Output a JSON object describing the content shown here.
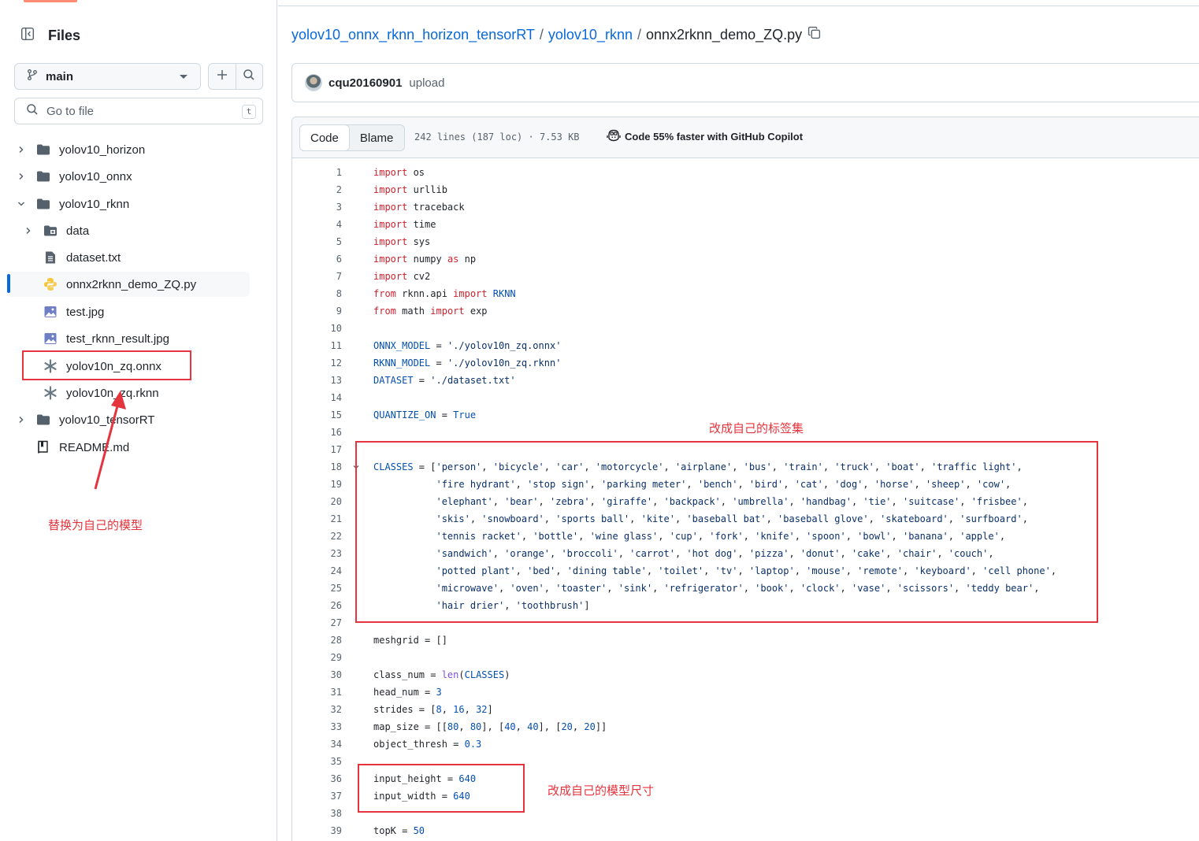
{
  "sidebar": {
    "title": "Files",
    "branch": "main",
    "goto_placeholder": "Go to file",
    "goto_shortcut": "t",
    "tree": [
      {
        "label": "yolov10_horizon",
        "kind": "folder",
        "expanded": false
      },
      {
        "label": "yolov10_onnx",
        "kind": "folder",
        "expanded": false
      },
      {
        "label": "yolov10_rknn",
        "kind": "folder",
        "expanded": true
      },
      {
        "label": "data",
        "kind": "folder-submodule",
        "expanded": false
      },
      {
        "label": "dataset.txt",
        "kind": "file-text"
      },
      {
        "label": "onnx2rknn_demo_ZQ.py",
        "kind": "file-python",
        "active": true
      },
      {
        "label": "test.jpg",
        "kind": "file-image"
      },
      {
        "label": "test_rknn_result.jpg",
        "kind": "file-image"
      },
      {
        "label": "yolov10n_zq.onnx",
        "kind": "file-binary"
      },
      {
        "label": "yolov10n_zq.rknn",
        "kind": "file-binary"
      },
      {
        "label": "yolov10_tensorRT",
        "kind": "folder",
        "expanded": false
      },
      {
        "label": "README.md",
        "kind": "file-readme"
      }
    ]
  },
  "breadcrumb": {
    "repo": "yolov10_onnx_rknn_horizon_tensorRT",
    "folder": "yolov10_rknn",
    "file": "onnx2rknn_demo_ZQ.py",
    "sep": "/"
  },
  "commit": {
    "author": "cqu20160901",
    "message": "upload"
  },
  "file_header": {
    "tab_code": "Code",
    "tab_blame": "Blame",
    "meta": "242 lines (187 loc) · 7.53 KB",
    "copilot": "Code 55% faster with GitHub Copilot"
  },
  "annotations": {
    "model": "替换为自己的模型",
    "classes": "改成自己的标签集",
    "size": "改成自己的模型尺寸"
  },
  "colors": {
    "accent_link": "#0969da",
    "keyword": "#cf222e",
    "constant": "#0550ae",
    "string": "#0a3069",
    "function": "#8250df",
    "annotation_red": "#e5343d"
  },
  "code_lines": [
    [
      [
        "k",
        "import"
      ],
      [
        "t",
        " os"
      ]
    ],
    [
      [
        "k",
        "import"
      ],
      [
        "t",
        " urllib"
      ]
    ],
    [
      [
        "k",
        "import"
      ],
      [
        "t",
        " traceback"
      ]
    ],
    [
      [
        "k",
        "import"
      ],
      [
        "t",
        " time"
      ]
    ],
    [
      [
        "k",
        "import"
      ],
      [
        "t",
        " sys"
      ]
    ],
    [
      [
        "k",
        "import"
      ],
      [
        "t",
        " numpy "
      ],
      [
        "k",
        "as"
      ],
      [
        "t",
        " np"
      ]
    ],
    [
      [
        "k",
        "import"
      ],
      [
        "t",
        " cv2"
      ]
    ],
    [
      [
        "k",
        "from"
      ],
      [
        "t",
        " rknn.api "
      ],
      [
        "k",
        "import"
      ],
      [
        "t",
        " "
      ],
      [
        "c",
        "RKNN"
      ]
    ],
    [
      [
        "k",
        "from"
      ],
      [
        "t",
        " math "
      ],
      [
        "k",
        "import"
      ],
      [
        "t",
        " exp"
      ]
    ],
    [],
    [
      [
        "c",
        "ONNX_MODEL"
      ],
      [
        "t",
        " = "
      ],
      [
        "s",
        "'./yolov10n_zq.onnx'"
      ]
    ],
    [
      [
        "c",
        "RKNN_MODEL"
      ],
      [
        "t",
        " = "
      ],
      [
        "s",
        "'./yolov10n_zq.rknn'"
      ]
    ],
    [
      [
        "c",
        "DATASET"
      ],
      [
        "t",
        " = "
      ],
      [
        "s",
        "'./dataset.txt'"
      ]
    ],
    [],
    [
      [
        "c",
        "QUANTIZE_ON"
      ],
      [
        "t",
        " = "
      ],
      [
        "c",
        "True"
      ]
    ],
    [],
    [],
    [
      [
        "c",
        "CLASSES"
      ],
      [
        "t",
        " = ["
      ],
      [
        "s",
        "'person'"
      ],
      [
        "t",
        ", "
      ],
      [
        "s",
        "'bicycle'"
      ],
      [
        "t",
        ", "
      ],
      [
        "s",
        "'car'"
      ],
      [
        "t",
        ", "
      ],
      [
        "s",
        "'motorcycle'"
      ],
      [
        "t",
        ", "
      ],
      [
        "s",
        "'airplane'"
      ],
      [
        "t",
        ", "
      ],
      [
        "s",
        "'bus'"
      ],
      [
        "t",
        ", "
      ],
      [
        "s",
        "'train'"
      ],
      [
        "t",
        ", "
      ],
      [
        "s",
        "'truck'"
      ],
      [
        "t",
        ", "
      ],
      [
        "s",
        "'boat'"
      ],
      [
        "t",
        ", "
      ],
      [
        "s",
        "'traffic light'"
      ],
      [
        "t",
        ","
      ]
    ],
    [
      [
        "t",
        "           "
      ],
      [
        "s",
        "'fire hydrant'"
      ],
      [
        "t",
        ", "
      ],
      [
        "s",
        "'stop sign'"
      ],
      [
        "t",
        ", "
      ],
      [
        "s",
        "'parking meter'"
      ],
      [
        "t",
        ", "
      ],
      [
        "s",
        "'bench'"
      ],
      [
        "t",
        ", "
      ],
      [
        "s",
        "'bird'"
      ],
      [
        "t",
        ", "
      ],
      [
        "s",
        "'cat'"
      ],
      [
        "t",
        ", "
      ],
      [
        "s",
        "'dog'"
      ],
      [
        "t",
        ", "
      ],
      [
        "s",
        "'horse'"
      ],
      [
        "t",
        ", "
      ],
      [
        "s",
        "'sheep'"
      ],
      [
        "t",
        ", "
      ],
      [
        "s",
        "'cow'"
      ],
      [
        "t",
        ","
      ]
    ],
    [
      [
        "t",
        "           "
      ],
      [
        "s",
        "'elephant'"
      ],
      [
        "t",
        ", "
      ],
      [
        "s",
        "'bear'"
      ],
      [
        "t",
        ", "
      ],
      [
        "s",
        "'zebra'"
      ],
      [
        "t",
        ", "
      ],
      [
        "s",
        "'giraffe'"
      ],
      [
        "t",
        ", "
      ],
      [
        "s",
        "'backpack'"
      ],
      [
        "t",
        ", "
      ],
      [
        "s",
        "'umbrella'"
      ],
      [
        "t",
        ", "
      ],
      [
        "s",
        "'handbag'"
      ],
      [
        "t",
        ", "
      ],
      [
        "s",
        "'tie'"
      ],
      [
        "t",
        ", "
      ],
      [
        "s",
        "'suitcase'"
      ],
      [
        "t",
        ", "
      ],
      [
        "s",
        "'frisbee'"
      ],
      [
        "t",
        ","
      ]
    ],
    [
      [
        "t",
        "           "
      ],
      [
        "s",
        "'skis'"
      ],
      [
        "t",
        ", "
      ],
      [
        "s",
        "'snowboard'"
      ],
      [
        "t",
        ", "
      ],
      [
        "s",
        "'sports ball'"
      ],
      [
        "t",
        ", "
      ],
      [
        "s",
        "'kite'"
      ],
      [
        "t",
        ", "
      ],
      [
        "s",
        "'baseball bat'"
      ],
      [
        "t",
        ", "
      ],
      [
        "s",
        "'baseball glove'"
      ],
      [
        "t",
        ", "
      ],
      [
        "s",
        "'skateboard'"
      ],
      [
        "t",
        ", "
      ],
      [
        "s",
        "'surfboard'"
      ],
      [
        "t",
        ","
      ]
    ],
    [
      [
        "t",
        "           "
      ],
      [
        "s",
        "'tennis racket'"
      ],
      [
        "t",
        ", "
      ],
      [
        "s",
        "'bottle'"
      ],
      [
        "t",
        ", "
      ],
      [
        "s",
        "'wine glass'"
      ],
      [
        "t",
        ", "
      ],
      [
        "s",
        "'cup'"
      ],
      [
        "t",
        ", "
      ],
      [
        "s",
        "'fork'"
      ],
      [
        "t",
        ", "
      ],
      [
        "s",
        "'knife'"
      ],
      [
        "t",
        ", "
      ],
      [
        "s",
        "'spoon'"
      ],
      [
        "t",
        ", "
      ],
      [
        "s",
        "'bowl'"
      ],
      [
        "t",
        ", "
      ],
      [
        "s",
        "'banana'"
      ],
      [
        "t",
        ", "
      ],
      [
        "s",
        "'apple'"
      ],
      [
        "t",
        ","
      ]
    ],
    [
      [
        "t",
        "           "
      ],
      [
        "s",
        "'sandwich'"
      ],
      [
        "t",
        ", "
      ],
      [
        "s",
        "'orange'"
      ],
      [
        "t",
        ", "
      ],
      [
        "s",
        "'broccoli'"
      ],
      [
        "t",
        ", "
      ],
      [
        "s",
        "'carrot'"
      ],
      [
        "t",
        ", "
      ],
      [
        "s",
        "'hot dog'"
      ],
      [
        "t",
        ", "
      ],
      [
        "s",
        "'pizza'"
      ],
      [
        "t",
        ", "
      ],
      [
        "s",
        "'donut'"
      ],
      [
        "t",
        ", "
      ],
      [
        "s",
        "'cake'"
      ],
      [
        "t",
        ", "
      ],
      [
        "s",
        "'chair'"
      ],
      [
        "t",
        ", "
      ],
      [
        "s",
        "'couch'"
      ],
      [
        "t",
        ","
      ]
    ],
    [
      [
        "t",
        "           "
      ],
      [
        "s",
        "'potted plant'"
      ],
      [
        "t",
        ", "
      ],
      [
        "s",
        "'bed'"
      ],
      [
        "t",
        ", "
      ],
      [
        "s",
        "'dining table'"
      ],
      [
        "t",
        ", "
      ],
      [
        "s",
        "'toilet'"
      ],
      [
        "t",
        ", "
      ],
      [
        "s",
        "'tv'"
      ],
      [
        "t",
        ", "
      ],
      [
        "s",
        "'laptop'"
      ],
      [
        "t",
        ", "
      ],
      [
        "s",
        "'mouse'"
      ],
      [
        "t",
        ", "
      ],
      [
        "s",
        "'remote'"
      ],
      [
        "t",
        ", "
      ],
      [
        "s",
        "'keyboard'"
      ],
      [
        "t",
        ", "
      ],
      [
        "s",
        "'cell phone'"
      ],
      [
        "t",
        ","
      ]
    ],
    [
      [
        "t",
        "           "
      ],
      [
        "s",
        "'microwave'"
      ],
      [
        "t",
        ", "
      ],
      [
        "s",
        "'oven'"
      ],
      [
        "t",
        ", "
      ],
      [
        "s",
        "'toaster'"
      ],
      [
        "t",
        ", "
      ],
      [
        "s",
        "'sink'"
      ],
      [
        "t",
        ", "
      ],
      [
        "s",
        "'refrigerator'"
      ],
      [
        "t",
        ", "
      ],
      [
        "s",
        "'book'"
      ],
      [
        "t",
        ", "
      ],
      [
        "s",
        "'clock'"
      ],
      [
        "t",
        ", "
      ],
      [
        "s",
        "'vase'"
      ],
      [
        "t",
        ", "
      ],
      [
        "s",
        "'scissors'"
      ],
      [
        "t",
        ", "
      ],
      [
        "s",
        "'teddy bear'"
      ],
      [
        "t",
        ","
      ]
    ],
    [
      [
        "t",
        "           "
      ],
      [
        "s",
        "'hair drier'"
      ],
      [
        "t",
        ", "
      ],
      [
        "s",
        "'toothbrush'"
      ],
      [
        "t",
        "]"
      ]
    ],
    [],
    [
      [
        "t",
        "meshgrid = []"
      ]
    ],
    [],
    [
      [
        "t",
        "class_num = "
      ],
      [
        "f",
        "len"
      ],
      [
        "t",
        "("
      ],
      [
        "c",
        "CLASSES"
      ],
      [
        "t",
        ")"
      ]
    ],
    [
      [
        "t",
        "head_num = "
      ],
      [
        "c",
        "3"
      ]
    ],
    [
      [
        "t",
        "strides = ["
      ],
      [
        "c",
        "8"
      ],
      [
        "t",
        ", "
      ],
      [
        "c",
        "16"
      ],
      [
        "t",
        ", "
      ],
      [
        "c",
        "32"
      ],
      [
        "t",
        "]"
      ]
    ],
    [
      [
        "t",
        "map_size = [["
      ],
      [
        "c",
        "80"
      ],
      [
        "t",
        ", "
      ],
      [
        "c",
        "80"
      ],
      [
        "t",
        "], ["
      ],
      [
        "c",
        "40"
      ],
      [
        "t",
        ", "
      ],
      [
        "c",
        "40"
      ],
      [
        "t",
        "], ["
      ],
      [
        "c",
        "20"
      ],
      [
        "t",
        ", "
      ],
      [
        "c",
        "20"
      ],
      [
        "t",
        "]]"
      ]
    ],
    [
      [
        "t",
        "object_thresh = "
      ],
      [
        "c",
        "0.3"
      ]
    ],
    [],
    [
      [
        "t",
        "input_height = "
      ],
      [
        "c",
        "640"
      ]
    ],
    [
      [
        "t",
        "input_width = "
      ],
      [
        "c",
        "640"
      ]
    ],
    [],
    [
      [
        "t",
        "topK = "
      ],
      [
        "c",
        "50"
      ]
    ]
  ]
}
